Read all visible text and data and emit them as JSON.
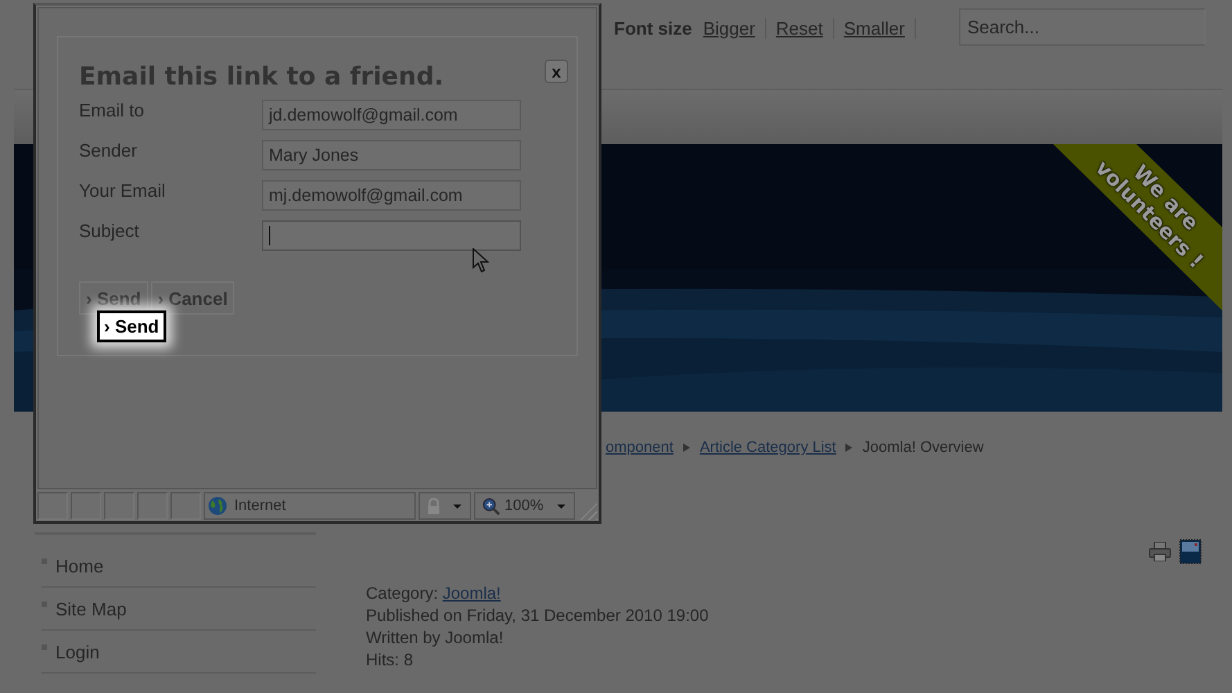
{
  "top_bar": {
    "font_size_label": "Font size",
    "font_links": [
      "Bigger",
      "Reset",
      "Smaller"
    ],
    "search": {
      "placeholder": "Search..."
    }
  },
  "banner": {
    "ribbon_lines": [
      "We are",
      "volunteers !"
    ]
  },
  "breadcrumb": [
    {
      "text": "omponent",
      "kind": "link"
    },
    {
      "text": "Article Category List",
      "kind": "link"
    },
    {
      "text": "Joomla! Overview",
      "kind": "current"
    }
  ],
  "sidebar": {
    "items": [
      "Home",
      "Site Map",
      "Login"
    ]
  },
  "article": {
    "category_label": "Category: ",
    "category": "Joomla!",
    "lines": [
      "Published on Friday, 31 December 2010 19:00",
      "Written by Joomla!",
      "Hits: 8"
    ]
  },
  "popup": {
    "dialog": {
      "title": "Email this link to a friend.",
      "close": "x",
      "fields": [
        {
          "label": "Email to",
          "value": "jd.demowolf@gmail.com",
          "focused": false
        },
        {
          "label": "Sender",
          "value": "Mary Jones",
          "focused": false
        },
        {
          "label": "Your Email",
          "value": "mj.demowolf@gmail.com",
          "focused": false
        },
        {
          "label": "Subject",
          "focused": true
        }
      ],
      "buttons": [
        "› Send",
        "› Cancel"
      ],
      "callout": "› Send"
    },
    "status_bar": {
      "zone": "Internet",
      "zoom": "100%"
    }
  }
}
